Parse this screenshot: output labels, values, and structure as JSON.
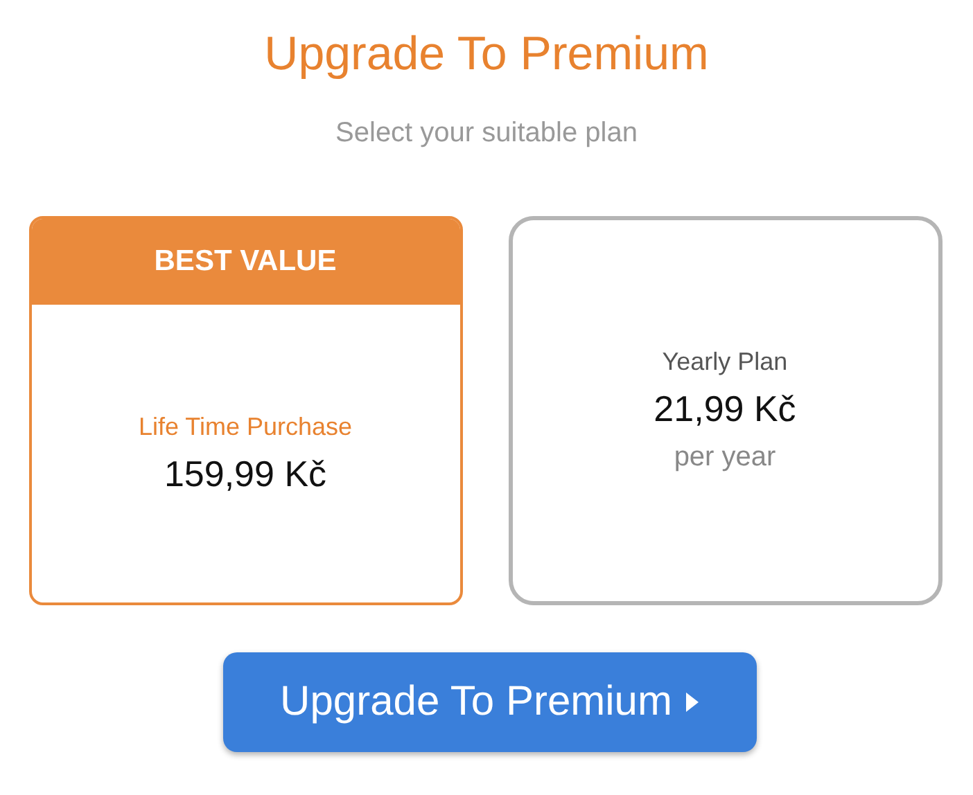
{
  "title": "Upgrade To Premium",
  "subtitle": "Select your suitable plan",
  "plans": [
    {
      "badge": "BEST VALUE",
      "name": "Life Time Purchase",
      "price": "159,99 Kč",
      "selected": true
    },
    {
      "name": "Yearly Plan",
      "price": "21,99 Kč",
      "period": "per year",
      "selected": false
    }
  ],
  "button": {
    "label": "Upgrade To Premium"
  }
}
